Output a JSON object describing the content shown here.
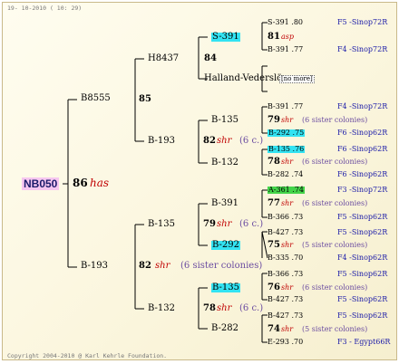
{
  "header": {
    "date": "19- 10-2010 ( 10: 29)"
  },
  "footer": {
    "copyright": "Copyright 2004-2010 @ Karl Kehrle Foundation."
  },
  "root": {
    "name": "NB050",
    "num": "86",
    "tag": "has"
  },
  "gen1": {
    "upper": {
      "name": "B8555",
      "num": "85"
    },
    "lower": {
      "name": "B-193",
      "num": "82",
      "tag": "shr",
      "note": "(6 sister colonies)"
    }
  },
  "gen2": {
    "a": {
      "name": "H8437",
      "num": "84"
    },
    "b": {
      "name": "B-193",
      "num": "82",
      "tag": "shr",
      "note": "(6 c.)"
    },
    "c": {
      "name": "B-135",
      "num": "79",
      "tag": "shr",
      "note": "(6 c.)"
    },
    "d": {
      "name": "B-132",
      "num": "78",
      "tag": "shr",
      "note": "(6 c.)"
    }
  },
  "gen3": {
    "s391": "S-391",
    "halland": "Halland-Vederslöv",
    "no_more": "[no more]",
    "b135a": "B-135",
    "b132a": "B-132",
    "b391": "B-391",
    "b292": "B-292",
    "b135b": "B-135",
    "b282": "B-282"
  },
  "gen4": [
    {
      "id": "S-391 .80",
      "loc": "F5 -Sinop72R"
    },
    {
      "num": "81",
      "tag": "asp"
    },
    {
      "id": "B-391 .77",
      "loc": "F4 -Sinop72R"
    },
    {
      "id": "B-391 .77",
      "loc": "F4 -Sinop72R"
    },
    {
      "num": "79",
      "tag": "shr",
      "note": "(6 sister colonies)"
    },
    {
      "id": "B-292 .75",
      "loc": "F6 -Sinop62R"
    },
    {
      "id": "B-135 .76",
      "loc": "F6 -Sinop62R"
    },
    {
      "num": "78",
      "tag": "shr",
      "note": "(6 sister colonies)"
    },
    {
      "id": "B-282 .74",
      "loc": "F6 -Sinop62R"
    },
    {
      "id": "A-361 .74",
      "loc": "F3 -Sinop72R"
    },
    {
      "num": "77",
      "tag": "shr",
      "note": "(6 sister colonies)"
    },
    {
      "id": "B-366 .73",
      "loc": "F5 -Sinop62R"
    },
    {
      "id": "B-427 .73",
      "loc": "F5 -Sinop62R"
    },
    {
      "num": "75",
      "tag": "shr",
      "note": "(5 sister colonies)"
    },
    {
      "id": "B-335 .70",
      "loc": "F4 -Sinop62R"
    },
    {
      "id": "B-366 .73",
      "loc": "F5 -Sinop62R"
    },
    {
      "num": "76",
      "tag": "shr",
      "note": "(6 sister colonies)"
    },
    {
      "id": "B-427 .73",
      "loc": "F5 -Sinop62R"
    },
    {
      "id": "B-427 .73",
      "loc": "F5 -Sinop62R"
    },
    {
      "num": "74",
      "tag": "shr",
      "note": "(5 sister colonies)"
    },
    {
      "id": "E-293 .70",
      "loc": "F3 - Egypt66R"
    }
  ],
  "colors": {
    "cyan_highlight": "#33e3f2",
    "green_highlight": "#44d44a",
    "link_blue": "#1a1aa8",
    "tag_red": "#c00000"
  }
}
